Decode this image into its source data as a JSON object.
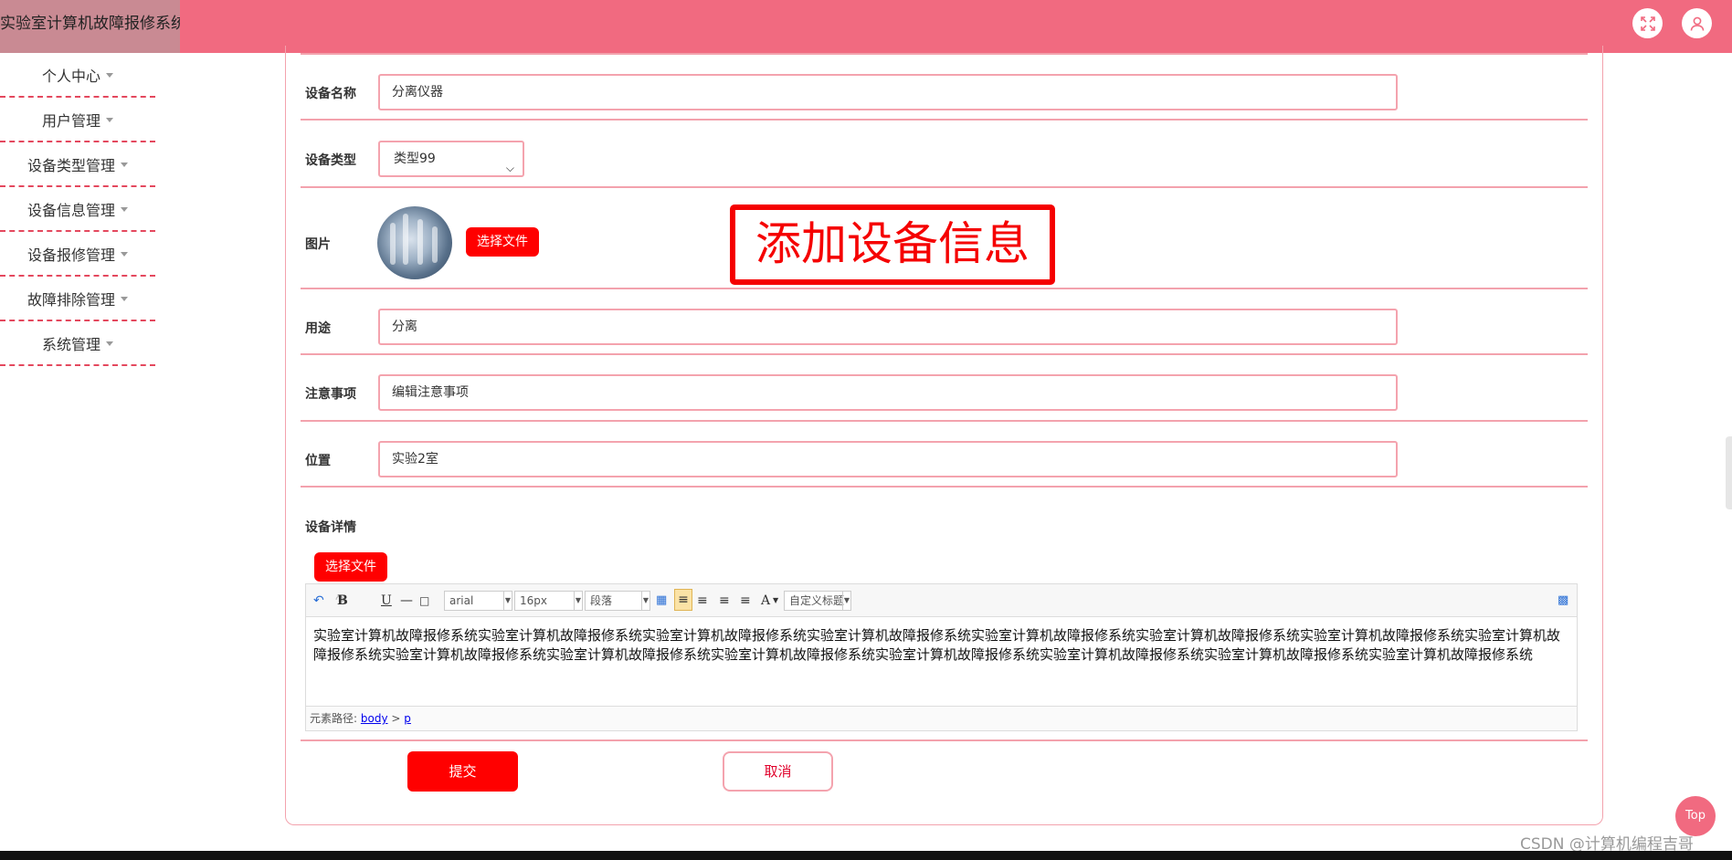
{
  "app": {
    "title": "实验室计算机故障报修系统"
  },
  "header": {
    "icons": [
      "fullscreen-icon",
      "user-icon"
    ]
  },
  "sidebar": {
    "items": [
      {
        "label": "个人中心"
      },
      {
        "label": "用户管理"
      },
      {
        "label": "设备类型管理"
      },
      {
        "label": "设备信息管理"
      },
      {
        "label": "设备报修管理"
      },
      {
        "label": "故障排除管理"
      },
      {
        "label": "系统管理"
      }
    ]
  },
  "form": {
    "name": {
      "label": "设备名称",
      "value": "分离仪器"
    },
    "type": {
      "label": "设备类型",
      "value": "类型99"
    },
    "image": {
      "label": "图片",
      "button": "选择文件"
    },
    "usage": {
      "label": "用途",
      "value": "分离"
    },
    "notes": {
      "label": "注意事项",
      "value": "编辑注意事项"
    },
    "location": {
      "label": "位置",
      "value": "实验2室"
    },
    "details": {
      "label": "设备详情",
      "button": "选择文件"
    }
  },
  "annotation": {
    "text": "添加设备信息"
  },
  "editor": {
    "font_family": "arial",
    "font_size": "16px",
    "paragraph": "段落",
    "custom_heading": "自定义标题",
    "content": "实验室计算机故障报修系统实验室计算机故障报修系统实验室计算机故障报修系统实验室计算机故障报修系统实验室计算机故障报修系统实验室计算机故障报修系统实验室计算机故障报修系统实验室计算机故障报修系统实验室计算机故障报修系统实验室计算机故障报修系统实验室计算机故障报修系统实验室计算机故障报修系统实验室计算机故障报修系统实验室计算机故障报修系统实验室计算机故障报修系统",
    "path_label": "元素路径:",
    "path_body": "body",
    "path_sep": ">",
    "path_p": "p"
  },
  "actions": {
    "submit": "提交",
    "cancel": "取消"
  },
  "misc": {
    "top_button": "Top",
    "watermark": "CSDN @计算机编程吉哥"
  },
  "colors": {
    "header": "#f16a80",
    "accent": "#ff0000",
    "border": "#f4a3ae"
  }
}
